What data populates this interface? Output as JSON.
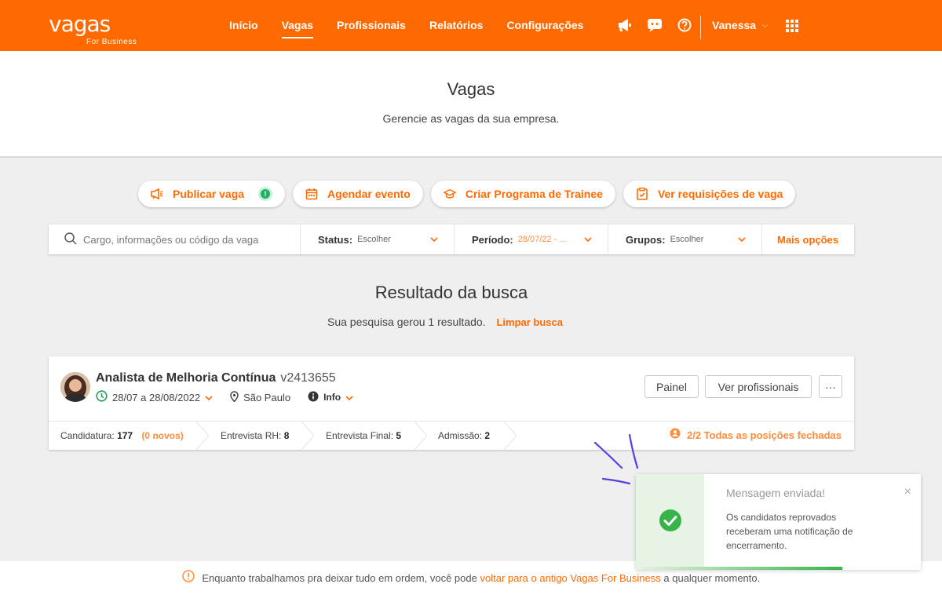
{
  "header": {
    "logo_word": "vagas",
    "logo_sub": "For Business",
    "nav": [
      "Início",
      "Vagas",
      "Profissionais",
      "Relatórios",
      "Configurações"
    ],
    "active_nav": "Vagas",
    "user_name": "Vanessa"
  },
  "hero": {
    "title": "Vagas",
    "subtitle": "Gerencie as vagas da sua empresa."
  },
  "actions": {
    "publish": "Publicar vaga",
    "publish_badge": "!",
    "schedule": "Agendar evento",
    "trainee": "Criar Programa de Trainee",
    "requisitions": "Ver requisições de vaga"
  },
  "filter": {
    "search_placeholder": "Cargo, informações ou código da vaga",
    "status_label": "Status:",
    "status_value": "Escolher",
    "period_label": "Período:",
    "period_value": "28/07/22 - ...",
    "groups_label": "Grupos:",
    "groups_value": "Escolher",
    "more": "Mais opções"
  },
  "results": {
    "title": "Resultado da busca",
    "summary": "Sua pesquisa gerou 1 resultado.",
    "clear": "Limpar busca"
  },
  "job": {
    "title": "Analista de Melhoria Contínua",
    "code": "v2413655",
    "dates": "28/07 a 28/08/2022",
    "location": "São Paulo",
    "info": "Info",
    "panel_button": "Painel",
    "professionals_button": "Ver profissionais",
    "more_button": "···",
    "steps": {
      "candidatura_label": "Candidatura:",
      "candidatura_count": "177",
      "novos": "(0 novos)",
      "rh_label": "Entrevista RH:",
      "rh_count": "8",
      "final_label": "Entrevista Final:",
      "final_count": "5",
      "admissao_label": "Admissão:",
      "admissao_count": "2"
    },
    "closed_status": "2/2 Todas as posições fechadas"
  },
  "footer": {
    "before": "Enquanto trabalhamos pra deixar tudo em ordem, você pode",
    "link": "voltar para o antigo Vagas For Business",
    "after": "a qualquer momento."
  },
  "toast": {
    "title": "Mensagem enviada!",
    "message": "Os candidatos reprovados receberam uma notificação de encerramento.",
    "close": "×"
  },
  "colors": {
    "brand": "#ff6a00",
    "success": "#37b34a",
    "accent_orange": "#ff8c3a"
  }
}
